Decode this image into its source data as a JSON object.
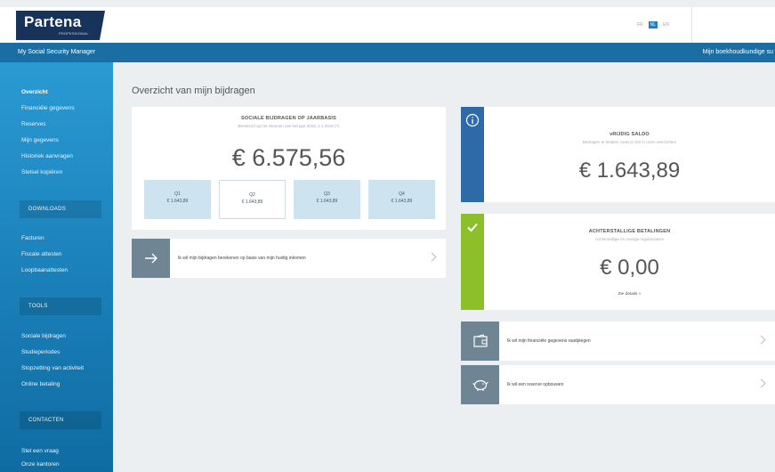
{
  "header": {
    "logo_text": "Partena",
    "logo_sub": "PROFESSIONAL",
    "languages": [
      "FR",
      "NL",
      "EN"
    ],
    "active_language": "NL"
  },
  "bluebar": {
    "title": "My Social Security Manager",
    "right_link": "Mijn boekhoudkundige su"
  },
  "sidebar": {
    "items_top": [
      "Overzicht",
      "Financiële gegevens",
      "Reserves",
      "Mijn gegevens",
      "Historiek aanvragen",
      "Stelsel kopiëren"
    ],
    "section_downloads": "DOWNLOADS",
    "items_downloads": [
      "Facturen",
      "Fiscale attesten",
      "Loopbaanattesten"
    ],
    "section_tools": "TOOLS",
    "items_tools": [
      "Sociale bijdragen",
      "Studieperiodes",
      "Stopzetting van activiteit",
      "Online betaling"
    ],
    "section_contacts": "CONTACTEN",
    "items_contacts": [
      "Stel een vraag",
      "Onze kantoren"
    ]
  },
  "main": {
    "page_title": "Overzicht van mijn bijdragen",
    "contributions": {
      "title": "SOCIALE BIJDRAGEN OP JAARBASIS",
      "subtitle": "Berekend op het inkomen van het jaar 2016, 1.1.2016 (?)",
      "amount": "€ 6.575,56",
      "quarters": [
        {
          "label": "Q1",
          "value": "€ 1.643,89"
        },
        {
          "label": "Q2",
          "value": "€ 1.643,89"
        },
        {
          "label": "Q3",
          "value": "€ 1.643,89"
        },
        {
          "label": "Q4",
          "value": "€ 1.643,89"
        }
      ],
      "active_quarter": 1
    },
    "action_recalc": "Ik wil mijn bijdragen berekenen op basis van mijn huidig inkomen",
    "balance": {
      "title": "vRIJDIG SALDO",
      "subtitle": "Bedragen te betalen zoals je ziet in onze overzichten",
      "amount": "€ 1.643,89"
    },
    "arrears": {
      "title": "ACHTERSTALLIGE BETALINGEN",
      "subtitle": "Achterstallige en overige regularisaties",
      "amount": "€ 0,00",
      "link": "Zie details »"
    },
    "action_financial": "Ik wil mijn financiële gegevens raadplegen",
    "action_reserve": "Ik wil een reserve opbouwen"
  },
  "colors": {
    "brand_navy": "#17335a",
    "blue_bar": "#1a6ea3",
    "sidebar_blue": "#2a9ad3",
    "info_blue": "#2d6aa7",
    "success_green": "#8dbf2a",
    "action_gray": "#6f8593"
  }
}
